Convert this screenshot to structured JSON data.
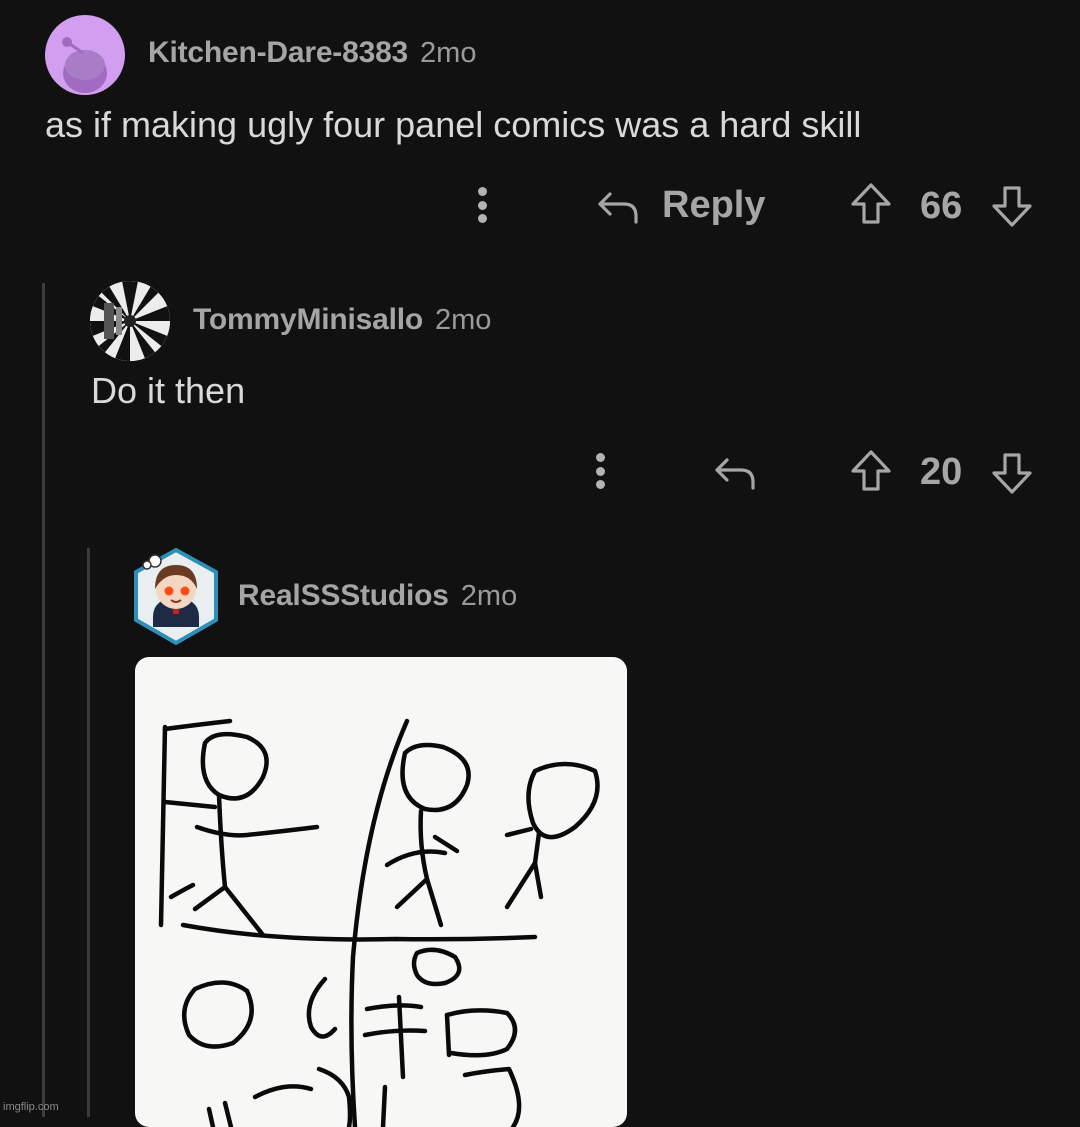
{
  "comments": [
    {
      "username": "Kitchen-Dare-8383",
      "age": "2mo",
      "text": "as if making ugly four panel comics was a hard skill",
      "reply_label": "Reply",
      "score": "66"
    },
    {
      "username": "TommyMinisallo",
      "age": "2mo",
      "text": "Do it then",
      "score": "20"
    },
    {
      "username": "RealSSStudios",
      "age": "2mo",
      "attachment": "hand-drawn four panel stick figure comic"
    }
  ],
  "watermark": "imgflip.com",
  "colors": {
    "background": "#121112",
    "avatar_purple": "#d29ef0",
    "text": "#d9d9d9",
    "muted": "#a5a5a5"
  }
}
